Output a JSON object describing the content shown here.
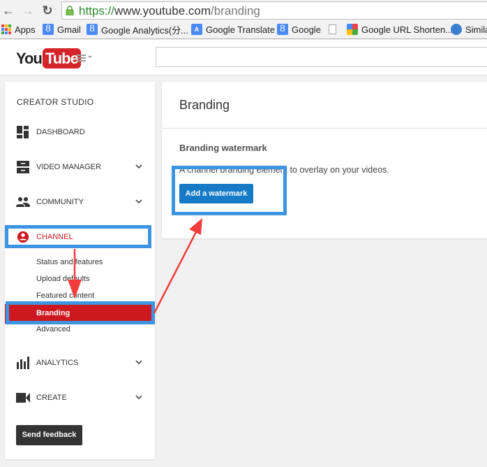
{
  "browser": {
    "url_scheme": "https://",
    "url_host": "www.youtube.com",
    "url_path": "/branding",
    "back_icon": "back-arrow-icon",
    "forward_icon": "forward-arrow-icon",
    "reload_icon": "reload-icon",
    "lock_icon": "lock-icon",
    "bookmarks": [
      {
        "label": "Apps",
        "icon": "apps-grid-icon"
      },
      {
        "label": "Gmail",
        "icon": "google-8-icon"
      },
      {
        "label": "Google Analytics(分...",
        "icon": "google-8-icon"
      },
      {
        "label": "Google Translate",
        "icon": "translate-icon"
      },
      {
        "label": "Google",
        "icon": "google-8-icon"
      },
      {
        "label": "",
        "icon": "page-icon"
      },
      {
        "label": "Google URL Shorten...",
        "icon": "google-plus-icon"
      },
      {
        "label": "Simila",
        "icon": "similarweb-icon"
      }
    ]
  },
  "header": {
    "logo_you": "You",
    "logo_tube": "Tube",
    "search_placeholder": ""
  },
  "sidebar": {
    "title": "CREATOR STUDIO",
    "items": [
      {
        "label": "DASHBOARD",
        "icon": "dashboard-icon",
        "expandable": false
      },
      {
        "label": "VIDEO MANAGER",
        "icon": "video-manager-icon",
        "expandable": true
      },
      {
        "label": "COMMUNITY",
        "icon": "community-icon",
        "expandable": true
      },
      {
        "label": "CHANNEL",
        "icon": "channel-icon",
        "expandable": false,
        "active": true
      },
      {
        "label": "ANALYTICS",
        "icon": "analytics-icon",
        "expandable": true
      },
      {
        "label": "CREATE",
        "icon": "create-icon",
        "expandable": true
      }
    ],
    "channel_subitems": [
      "Status and features",
      "Upload defaults",
      "Featured content",
      "Branding",
      "Advanced"
    ],
    "active_subitem": "Branding",
    "feedback_label": "Send feedback"
  },
  "main": {
    "title": "Branding",
    "section_title": "Branding watermark",
    "section_desc": "A channel branding element to overlay on your videos.",
    "button_label": "Add a watermark"
  },
  "colors": {
    "active_red": "#cc181e",
    "button_blue": "#167ac6",
    "highlight_blue": "#3d94e0",
    "arrow_red": "#f33c3c"
  }
}
